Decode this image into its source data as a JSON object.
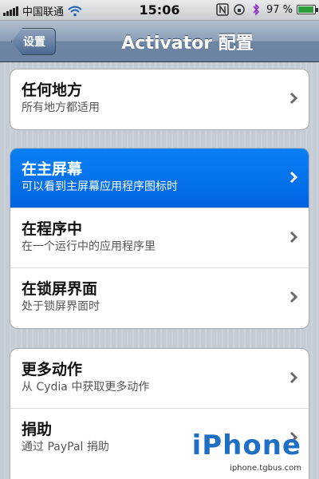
{
  "status_bar": {
    "carrier": "中国联通",
    "time": "15:06",
    "battery_percent": "97 %",
    "battery_level": 0.97
  },
  "nav": {
    "back_label": "设置",
    "title": "Activator 配置"
  },
  "groups": [
    {
      "items": [
        {
          "title": "任何地方",
          "subtitle": "所有地方都适用"
        }
      ]
    },
    {
      "items": [
        {
          "title": "在主屏幕",
          "subtitle": "可以看到主屏幕应用程序图标时",
          "selected": true
        },
        {
          "title": "在程序中",
          "subtitle": "在一个运行中的应用程序里"
        },
        {
          "title": "在锁屏界面",
          "subtitle": "处于锁屏界面时"
        }
      ]
    },
    {
      "items": [
        {
          "title": "更多动作",
          "subtitle": "从 Cydia 中获取更多动作"
        },
        {
          "title": "捐助",
          "subtitle": "通过 PayPal 捐助"
        }
      ]
    }
  ],
  "watermark": {
    "logo_text": "iPhone",
    "url": "iphone.tgbus.com"
  },
  "colors": {
    "selected_row": "#0a81f6",
    "nav_bar": "#6d84a2",
    "background": "#c5ccd4"
  }
}
